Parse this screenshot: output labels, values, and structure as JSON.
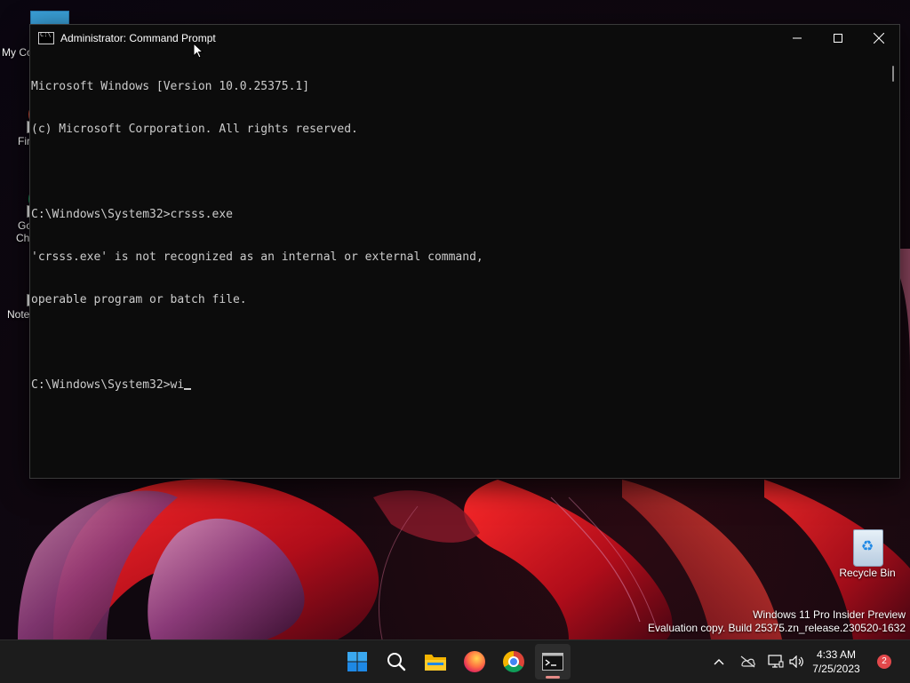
{
  "desktop": {
    "icons": [
      {
        "label": "My Co"
      },
      {
        "label": "Fir"
      },
      {
        "label": "Go"
      },
      {
        "label": "Chr"
      },
      {
        "label": "Note"
      }
    ],
    "recycle_bin": {
      "label": "Recycle Bin"
    },
    "watermark": {
      "line1": "Windows 11 Pro Insider Preview",
      "line2": "Evaluation copy. Build 25375.zn_release.230520-1632"
    }
  },
  "window": {
    "title": "Administrator: Command Prompt",
    "icon": "cmd-icon",
    "controls": {
      "minimize": "minimize-icon",
      "maximize": "maximize-icon",
      "close": "close-icon"
    },
    "console": {
      "lines": [
        "Microsoft Windows [Version 10.0.25375.1]",
        "(c) Microsoft Corporation. All rights reserved.",
        "",
        "C:\\Windows\\System32>crsss.exe",
        "'crsss.exe' is not recognized as an internal or external command,",
        "operable program or batch file.",
        ""
      ],
      "prompt": "C:\\Windows\\System32>",
      "input": "wi"
    }
  },
  "taskbar": {
    "apps": [
      {
        "name": "start",
        "icon": "windows-start-icon"
      },
      {
        "name": "search",
        "icon": "search-icon"
      },
      {
        "name": "file-explorer",
        "icon": "folder-icon"
      },
      {
        "name": "firefox",
        "icon": "firefox-icon"
      },
      {
        "name": "chrome",
        "icon": "chrome-icon"
      },
      {
        "name": "terminal",
        "icon": "terminal-icon",
        "active": true
      }
    ],
    "tray": {
      "icons": [
        "chevron-up-icon",
        "network-offline-icon",
        "display-icon",
        "volume-icon"
      ],
      "time": "4:33 AM",
      "date": "7/25/2023",
      "notifications": "2"
    }
  },
  "colors": {
    "console_bg": "#0c0c0c",
    "console_text": "#cccccc",
    "taskbar_bg": "#1c1c1c",
    "badge": "#e2484b"
  }
}
